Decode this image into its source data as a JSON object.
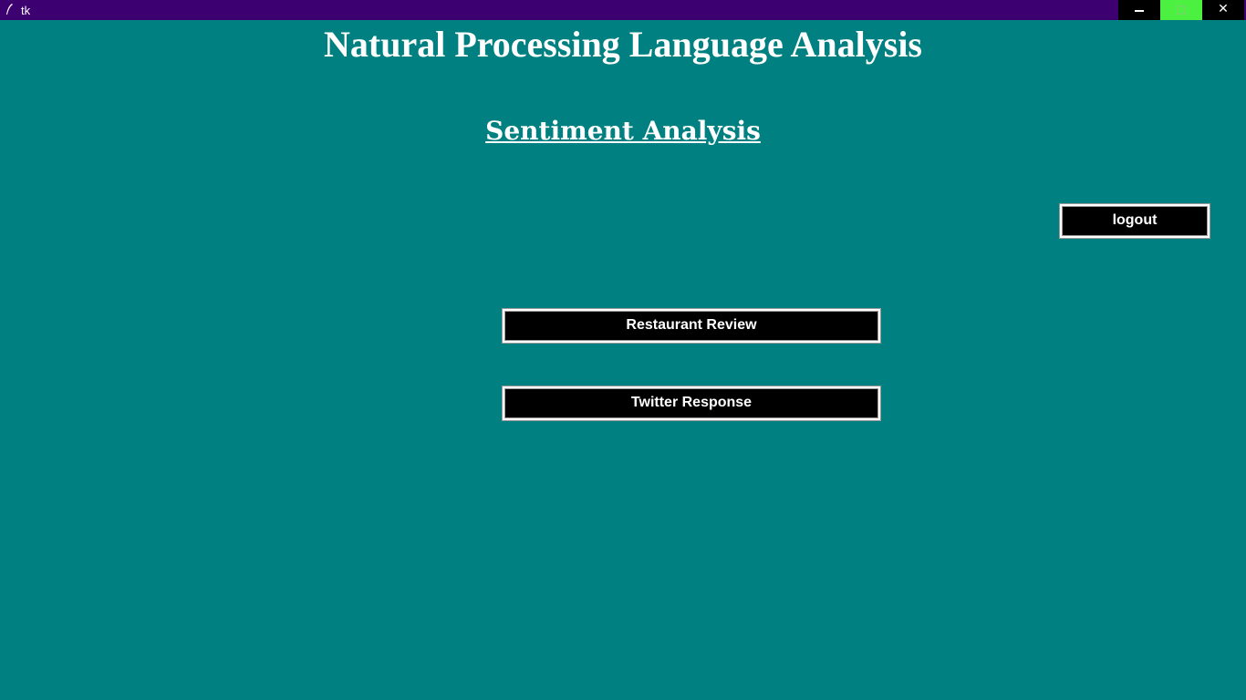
{
  "window": {
    "title": "tk",
    "background_color": "#008080",
    "titlebar_color": "#3d0070",
    "controls": {
      "minimize_icon": "minimize-icon",
      "maximize_icon": "maximize-icon",
      "close_icon": "close-icon",
      "close_glyph": "✕",
      "maximize_color": "#4cf040"
    }
  },
  "main": {
    "title": "Natural Processing Language Analysis",
    "subtitle": "Sentiment Analysis",
    "logout_label": "logout",
    "restaurant_label": "Restaurant Review",
    "twitter_label": "Twitter Response"
  }
}
